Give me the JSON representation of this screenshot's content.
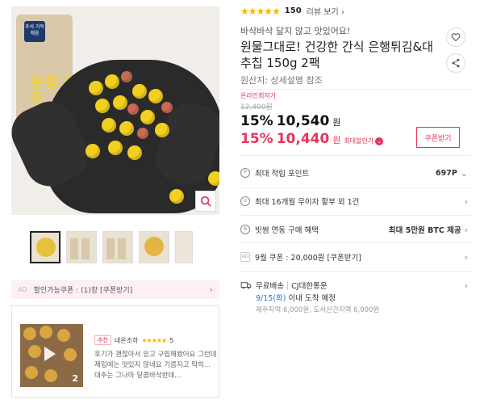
{
  "product": {
    "rating_count": "150",
    "review_link": "리뷰 보기",
    "subtitle": "바삭바삭 달지 않고 맛있어요!",
    "title": "원물그대로! 건강한 간식 은행튀김&대추칩 150g 2팩",
    "origin": "원산지: 상세설명 참조"
  },
  "main_image": {
    "bag_label": "추석 가득채움",
    "bag_title": "은행 대추"
  },
  "price": {
    "low_price_tag": "온라인최저가",
    "original": "12,400원",
    "discount1_pct": "15%",
    "discount1_price": "10,540",
    "won1": "원",
    "discount2_pct": "15%",
    "discount2_price": "10,440",
    "won2": "원",
    "max_discount_label": "최대할인가",
    "coupon_button": "쿠폰받기"
  },
  "info_rows": [
    {
      "icon": "P",
      "label": "최대 적립 포인트",
      "value": "697P"
    },
    {
      "icon": "⊙",
      "label": "최대 16개월 무이자 할부 외 1건",
      "value": ""
    },
    {
      "icon": "B",
      "label": "빗썸 연동 구매 혜택",
      "value": "최대 5만원 BTC 제공"
    },
    {
      "icon": "AD",
      "label": "9월 쿠폰 : 20,000원 [쿠폰받기]",
      "value": ""
    }
  ],
  "shipping": {
    "type": "무료배송",
    "carrier": "CJ대한통운",
    "date": "9/15(화)",
    "date_suffix": "이내 도착 예정",
    "extra": "제주지역 6,000원, 도서산간지역 6,000원"
  },
  "coupon_ad": {
    "tag": "AD",
    "text": "할인가능쿠폰 : (1)장 [쿠폰받기]"
  },
  "review": {
    "badge": "추천",
    "reviewer": "네온조하",
    "stars": "★★★★★",
    "score": "5",
    "text": "후기가 괜찮아서 믿고 구입해봤어요 그런데 제입에는 맛있지 않네요 기름지고 딱히... 대추는 그나마 달콤바삭한데...",
    "media_count": "2"
  },
  "colors": {
    "accent": "#e8335a",
    "star": "#f7b500",
    "link": "#2f6fd8"
  }
}
